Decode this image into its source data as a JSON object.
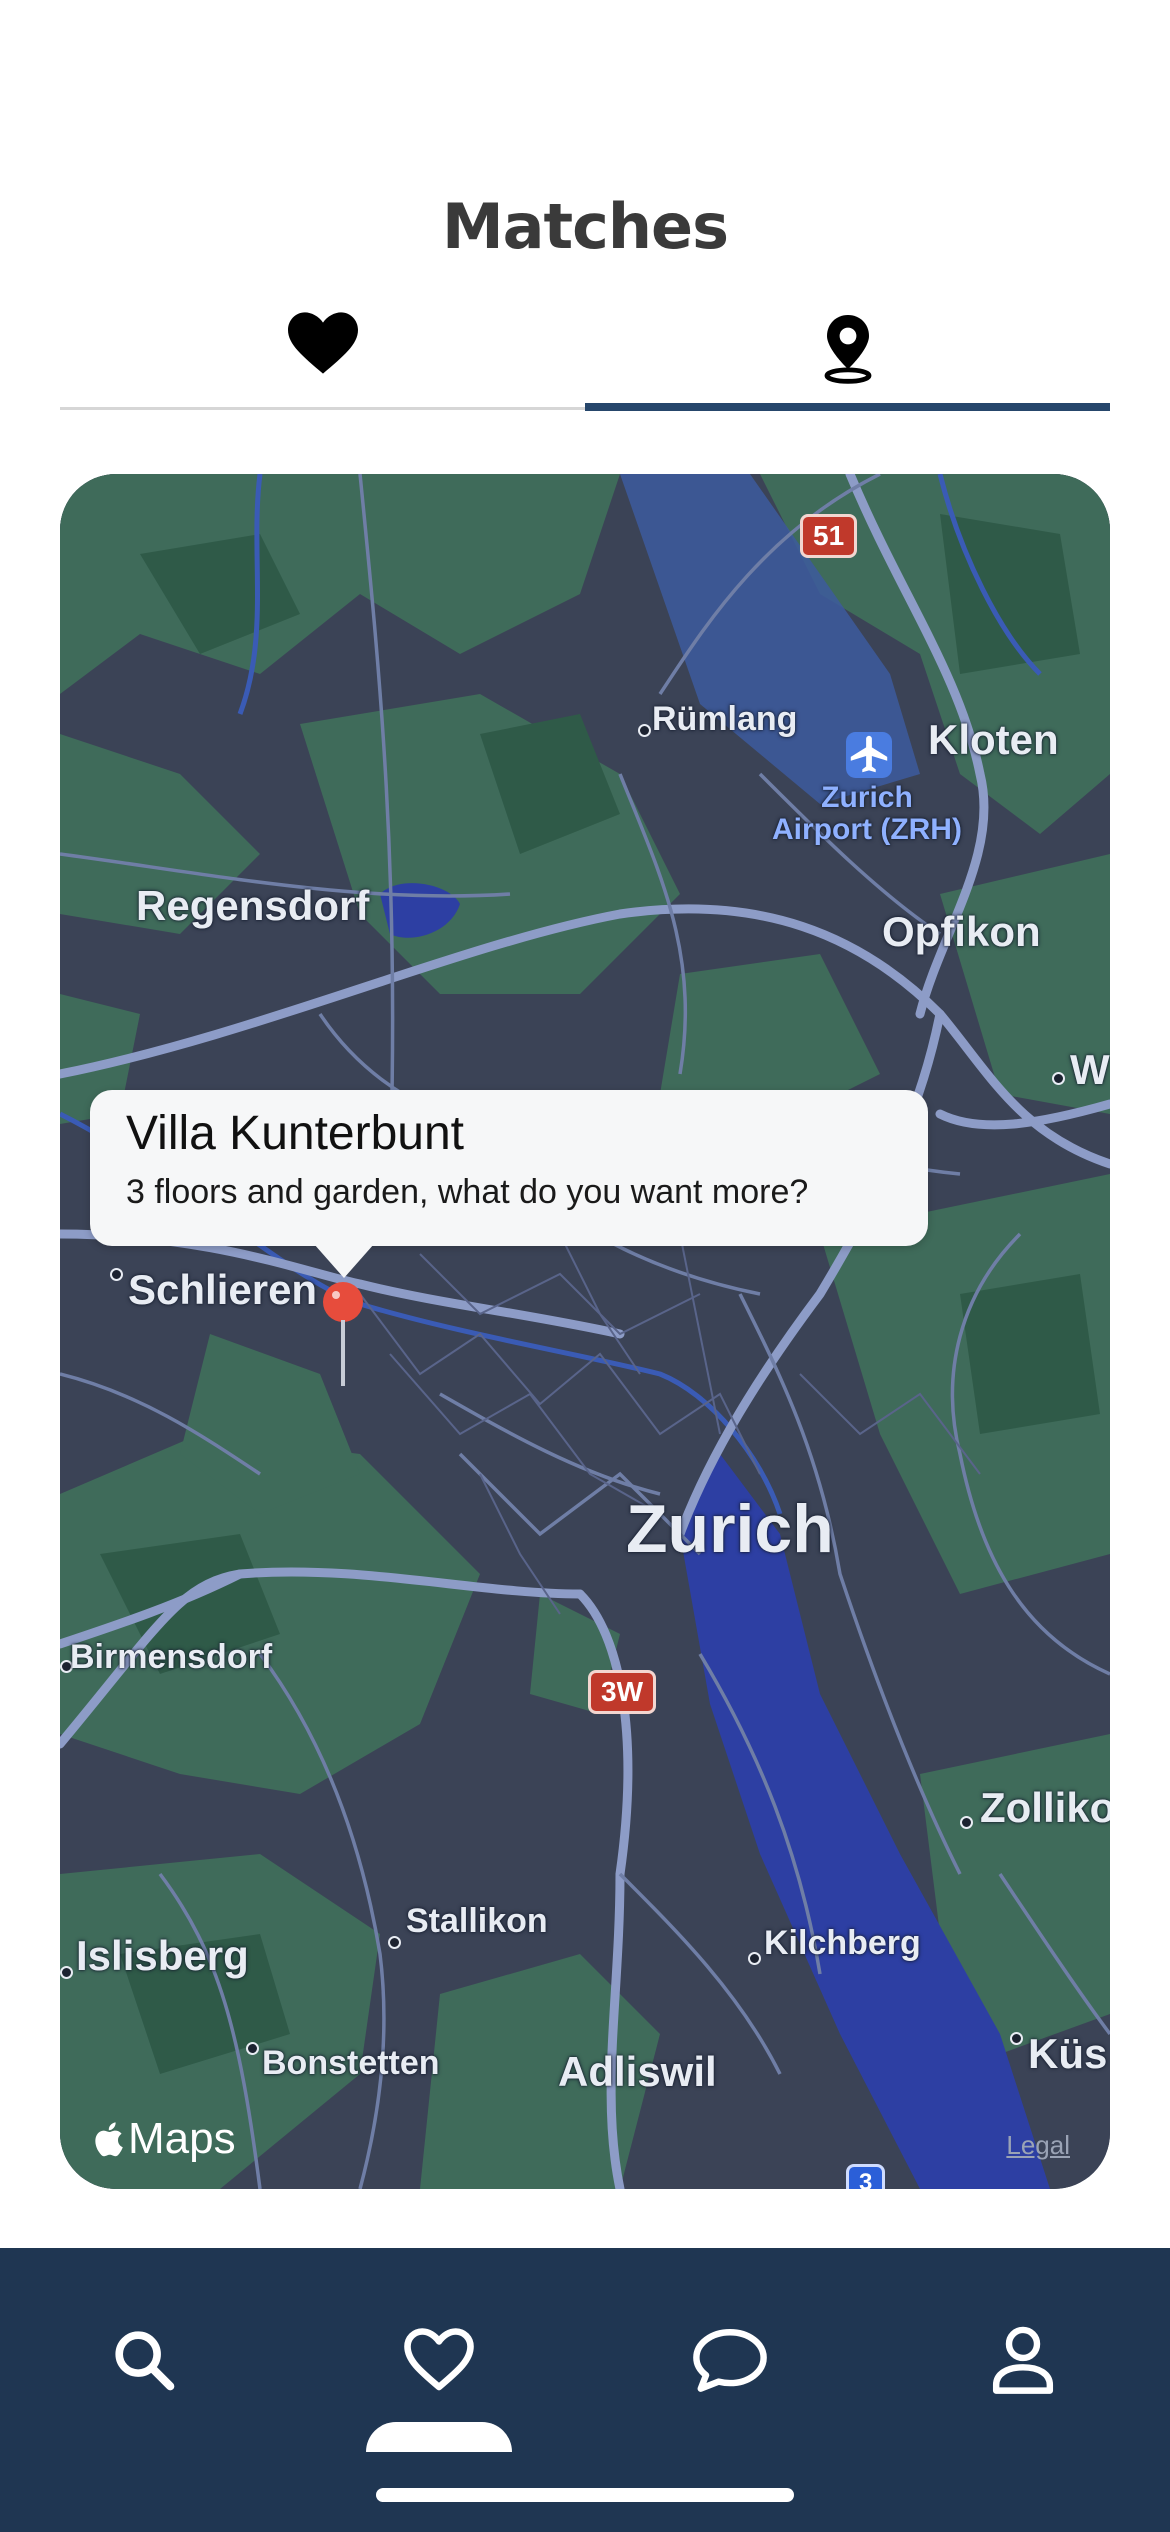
{
  "header": {
    "title": "Matches"
  },
  "segments": [
    {
      "icon": "heart-icon",
      "selected": false
    },
    {
      "icon": "map-pin-icon",
      "selected": true
    }
  ],
  "map": {
    "labels": {
      "zurich": "Zurich",
      "kloten": "Kloten",
      "rumlang": "Rümlang",
      "regensdorf": "Regensdorf",
      "opfikon": "Opfikon",
      "schlieren": "Schlieren",
      "birmensdorf": "Birmensdorf",
      "zollikon": "Zolliko",
      "stallikon": "Stallikon",
      "kilchberg": "Kilchberg",
      "islisberg": "Islisberg",
      "bonstetten": "Bonstetten",
      "adliswil": "Adliswil",
      "kusnacht": "Küs",
      "wallisellen": "W",
      "airport_line1": "Zurich",
      "airport_line2": "Airport (ZRH)"
    },
    "shields": {
      "a51": "51",
      "a3w": "3W",
      "a3": "3"
    },
    "callout": {
      "title": "Villa Kunterbunt",
      "subtitle": "3 floors and garden, what do you want more?"
    },
    "attribution": "Maps",
    "legal": "Legal"
  },
  "tabbar": {
    "items": [
      {
        "icon": "search-icon",
        "selected": false
      },
      {
        "icon": "heart-outline-icon",
        "selected": true
      },
      {
        "icon": "chat-bubble-icon",
        "selected": false
      },
      {
        "icon": "person-icon",
        "selected": false
      }
    ]
  },
  "colors": {
    "accent": "#26466b",
    "tabbar": "#1f3652",
    "pin": "#e74c3c"
  }
}
